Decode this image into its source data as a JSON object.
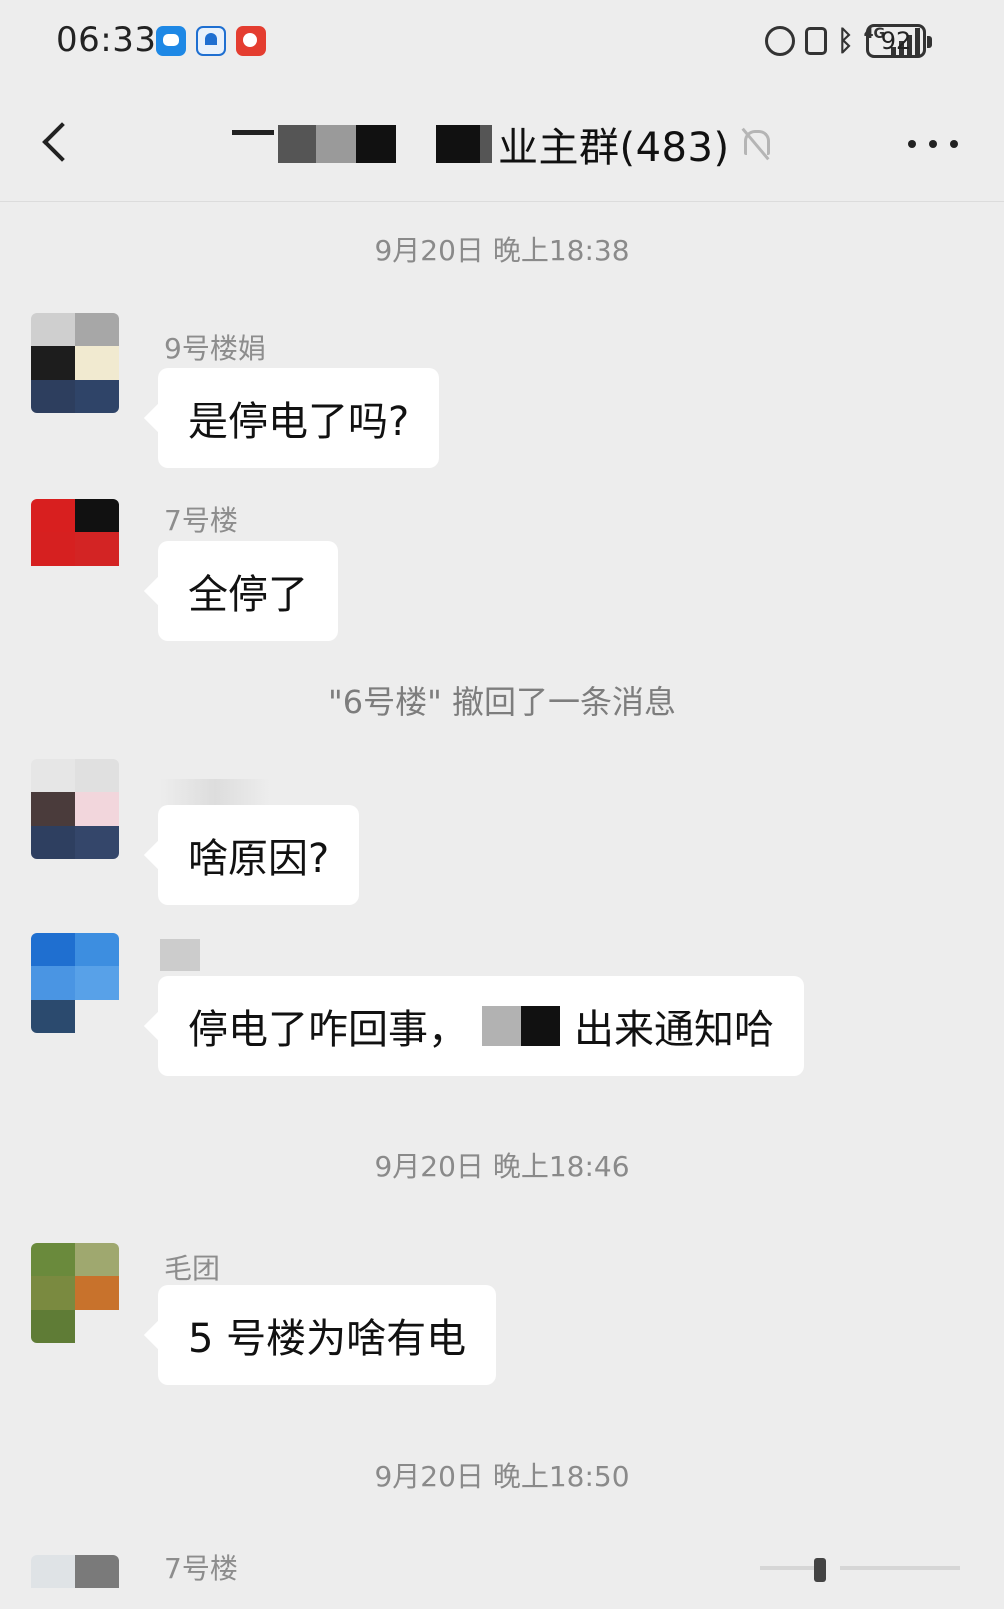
{
  "status_bar": {
    "time": "06:33",
    "battery": "92",
    "network": "4G"
  },
  "header": {
    "title_visible": "业主群(483)",
    "back_icon": "chevron-left-icon",
    "mute_icon": "bell-off-icon",
    "more_icon": "more-horizontal-icon"
  },
  "chat": {
    "timestamps": [
      "9月20日 晚上18:38",
      "9月20日 晚上18:46",
      "9月20日 晚上18:50"
    ],
    "recall_notice": "\"6号楼\" 撤回了一条消息",
    "messages": [
      {
        "sender": "9号楼娟",
        "text": "是停电了吗?"
      },
      {
        "sender": "7号楼",
        "text": "全停了"
      },
      {
        "sender": "",
        "text": "啥原因?"
      },
      {
        "sender": "",
        "text_before": "停电了咋回事，",
        "text_after": "出来通知哈"
      },
      {
        "sender": "毛团",
        "text": "5 号楼为啥有电"
      },
      {
        "sender": "7号楼",
        "text": ""
      }
    ]
  }
}
